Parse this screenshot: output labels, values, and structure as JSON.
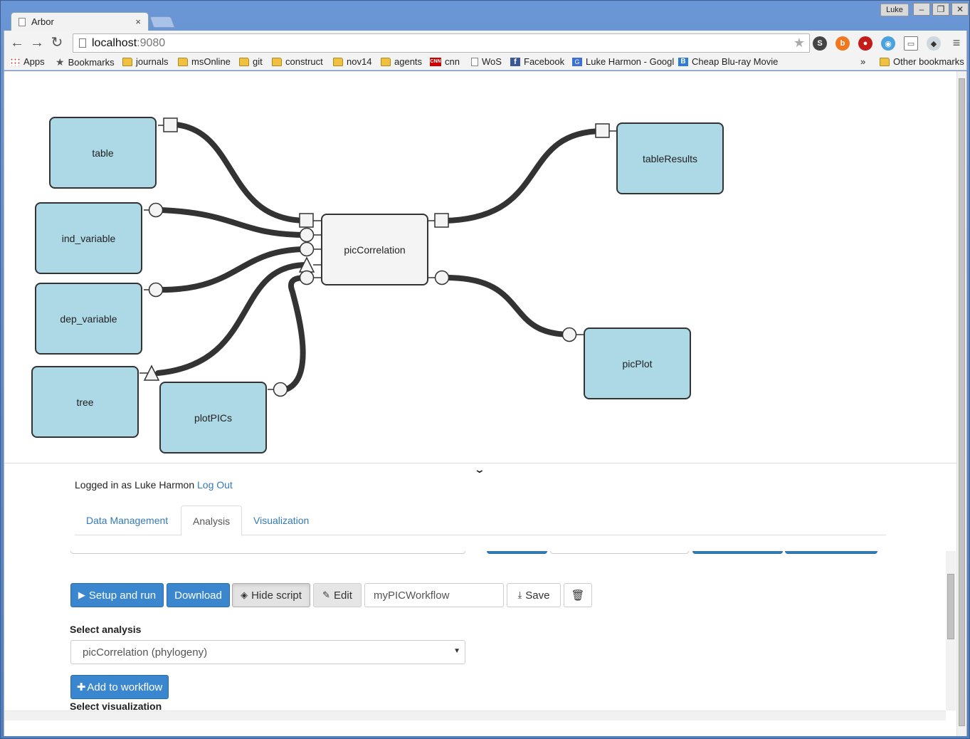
{
  "browser": {
    "tab_title": "Arbor",
    "tab_close": "×",
    "profile": "Luke",
    "min": "–",
    "max": "❐",
    "close": "✕",
    "url_host": "localhost",
    "url_port": ":9080"
  },
  "bookmarks": {
    "items": [
      "Apps",
      "Bookmarks",
      "journals",
      "msOnline",
      "git",
      "construct",
      "nov14",
      "agents",
      "cnn",
      "WoS",
      "Facebook",
      "Luke Harmon - Googl",
      "Cheap Blu-ray Movie"
    ],
    "overflow": "»",
    "other": "Other bookmarks",
    "cnn_icon": "CNN"
  },
  "workflow": {
    "nodes": {
      "table": "table",
      "ind_variable": "ind_variable",
      "dep_variable": "dep_variable",
      "tree": "tree",
      "plotPICs": "plotPICs",
      "picCorrelation": "picCorrelation",
      "tableResults": "tableResults",
      "picPlot": "picPlot"
    }
  },
  "session": {
    "logged_in_text": "Logged in as Luke Harmon",
    "logout": "Log Out"
  },
  "tabs": [
    "Data Management",
    "Analysis",
    "Visualization"
  ],
  "analysis": {
    "setup_run": "Setup and run",
    "download": "Download",
    "hide_script": "Hide script",
    "edit": "Edit",
    "workflow_name": "myPICWorkflow",
    "save": "Save",
    "select_analysis_label": "Select analysis",
    "selected_analysis": "picCorrelation (phylogeny)",
    "add_to_workflow": "Add to workflow",
    "select_visualization_label": "Select visualization"
  },
  "colors": {
    "node_fill": "#add8e6",
    "primary": "#3a87d0",
    "link": "#337ab7"
  }
}
